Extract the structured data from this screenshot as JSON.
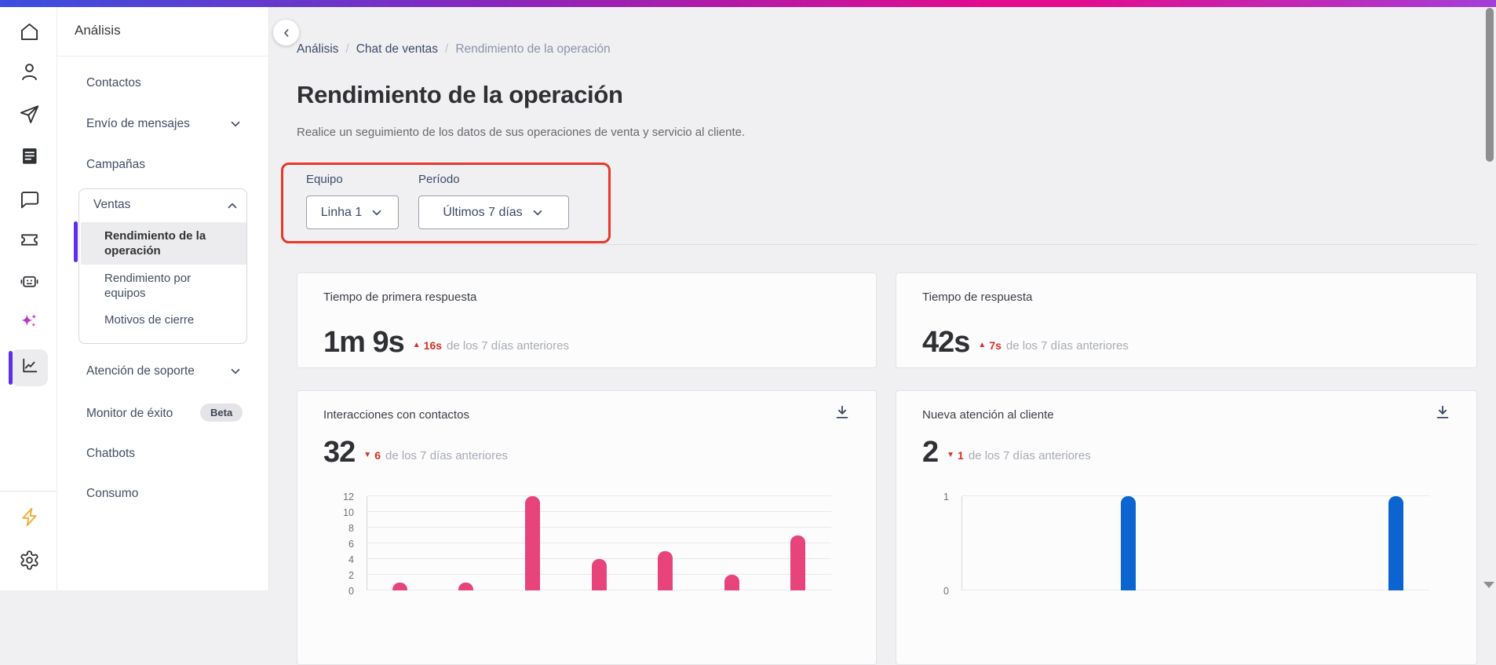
{
  "sidebar": {
    "title": "Análisis",
    "items": {
      "contactos": "Contactos",
      "envio": "Envío de mensajes",
      "campanas": "Campañas",
      "atencion": "Atención de soporte",
      "monitor": "Monitor de éxito",
      "chatbots": "Chatbots",
      "consumo": "Consumo"
    },
    "beta_badge": "Beta",
    "ventas_group": {
      "label": "Ventas",
      "active_item": "Rendimiento de la operación",
      "item_equipos": "Rendimiento por equipos",
      "item_motivos": "Motivos de cierre"
    }
  },
  "icon_rail": {
    "icons": [
      "home",
      "user",
      "send",
      "document",
      "chat",
      "ticket",
      "robot",
      "sparkles",
      "analytics",
      "lightning",
      "settings"
    ],
    "active_icon": "analytics"
  },
  "breadcrumb": {
    "separator": "/",
    "items": [
      "Análisis",
      "Chat de ventas",
      "Rendimiento de la operación"
    ]
  },
  "page": {
    "title": "Rendimiento de la operación",
    "subtitle": "Realice un seguimiento de los datos de sus operaciones de venta y servicio al cliente."
  },
  "filters": {
    "equipo_label": "Equipo",
    "equipo_value": "Linha 1",
    "periodo_label": "Período",
    "periodo_value": "Últimos 7 días"
  },
  "cards": {
    "first_response_time": {
      "title": "Tiempo de primera respuesta",
      "value": "1m 9s",
      "delta_icon": "▲",
      "delta_value": "16s",
      "delta_note": "de los 7 días anteriores"
    },
    "response_time": {
      "title": "Tiempo de respuesta",
      "value": "42s",
      "delta_icon": "▲",
      "delta_value": "7s",
      "delta_note": "de los 7 días anteriores"
    },
    "interactions": {
      "title": "Interacciones con contactos",
      "value": "32",
      "delta_icon": "▼",
      "delta_value": "6",
      "delta_note": "de los 7 días anteriores"
    },
    "new_service": {
      "title": "Nueva atención al cliente",
      "value": "2",
      "delta_icon": "▼",
      "delta_value": "1",
      "delta_note": "de los 7 días anteriores"
    }
  },
  "chart_data": [
    {
      "type": "bar",
      "title": "Interacciones con contactos",
      "values": [
        1,
        1,
        12,
        4,
        5,
        2,
        7
      ],
      "ylim": [
        0,
        12
      ],
      "yticks": [
        12,
        10,
        8,
        6,
        4,
        2,
        0
      ],
      "bar_color": "#e8447c",
      "grid": true
    },
    {
      "type": "bar",
      "title": "Nueva atención al cliente",
      "values": [
        0,
        0,
        1,
        0,
        0,
        0,
        1
      ],
      "ylim": [
        0,
        1
      ],
      "yticks": [
        1,
        0
      ],
      "bar_color": "#0b64d0",
      "grid": true
    }
  ],
  "colors": {
    "accent_purple": "#5b30e8",
    "annotation_red": "#e8372b",
    "delta_red": "#d03226",
    "bar_pink": "#e8447c",
    "bar_blue": "#0b64d0",
    "topbar_gradient": [
      "#3b4fe0",
      "#8428bd",
      "#e30b8e",
      "#a340d7"
    ],
    "lightning_yellow": "#edb23c"
  }
}
